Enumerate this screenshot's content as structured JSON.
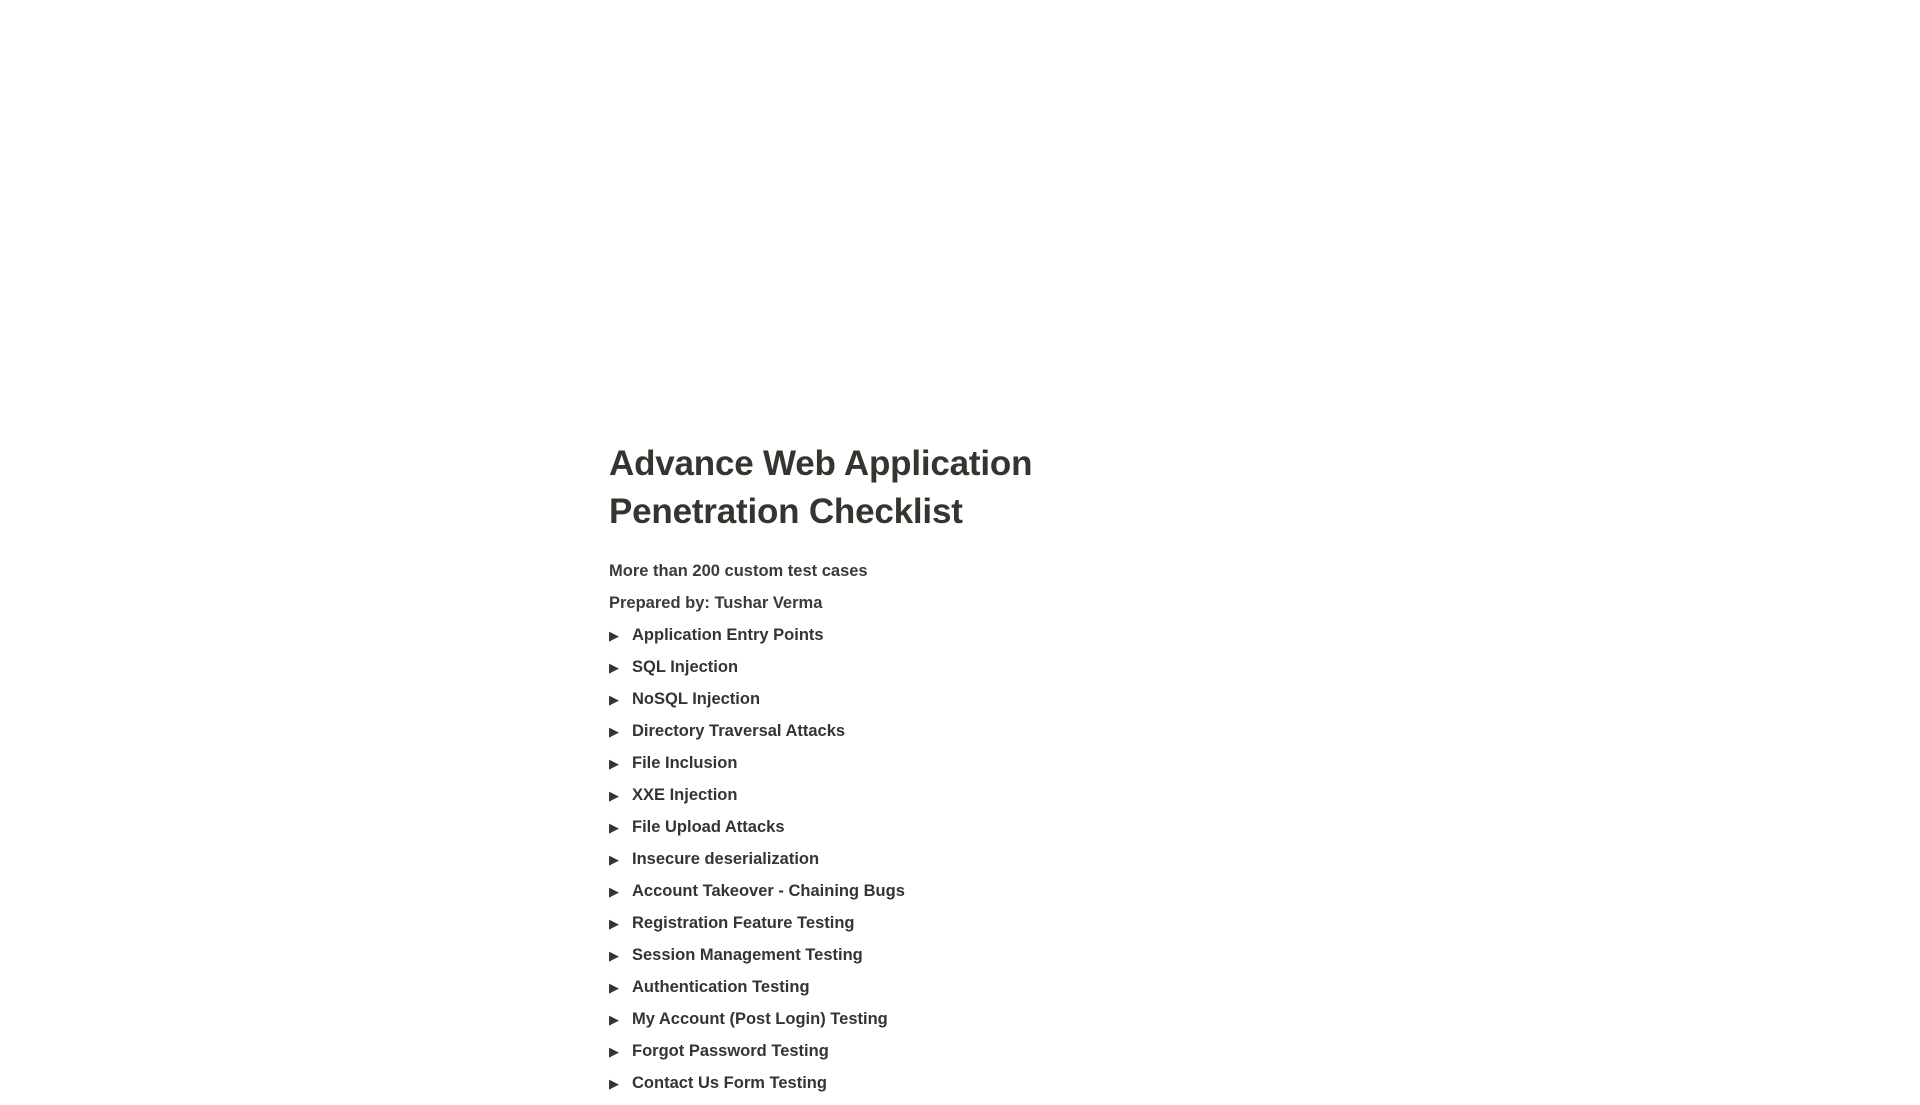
{
  "document": {
    "title_line_1": "Advance Web Application",
    "title_line_2": "Penetration Checklist",
    "subtitle": "More than 200 custom test cases",
    "author_line": "Prepared by: Tushar Verma",
    "text_color": "#36342f",
    "background_color": "#ffffff"
  },
  "toc": {
    "disclosure_icon": "▶",
    "items": [
      {
        "label": "Application Entry Points",
        "icon": "collapsed-triangle-icon",
        "expanded": false
      },
      {
        "label": "SQL Injection",
        "icon": "collapsed-triangle-icon",
        "expanded": false
      },
      {
        "label": "NoSQL Injection",
        "icon": "collapsed-triangle-icon",
        "expanded": false
      },
      {
        "label": "Directory Traversal Attacks",
        "icon": "collapsed-triangle-icon",
        "expanded": false
      },
      {
        "label": "File Inclusion",
        "icon": "collapsed-triangle-icon",
        "expanded": false
      },
      {
        "label": "XXE Injection",
        "icon": "collapsed-triangle-icon",
        "expanded": false
      },
      {
        "label": "File Upload Attacks",
        "icon": "collapsed-triangle-icon",
        "expanded": false
      },
      {
        "label": "Insecure deserialization",
        "icon": "collapsed-triangle-icon",
        "expanded": false
      },
      {
        "label": "Account Takeover - Chaining Bugs",
        "icon": "collapsed-triangle-icon",
        "expanded": false
      },
      {
        "label": "Registration Feature Testing",
        "icon": "collapsed-triangle-icon",
        "expanded": false
      },
      {
        "label": "Session Management Testing",
        "icon": "collapsed-triangle-icon",
        "expanded": false
      },
      {
        "label": "Authentication Testing",
        "icon": "collapsed-triangle-icon",
        "expanded": false
      },
      {
        "label": "My Account (Post Login) Testing",
        "icon": "collapsed-triangle-icon",
        "expanded": false
      },
      {
        "label": "Forgot Password Testing",
        "icon": "collapsed-triangle-icon",
        "expanded": false
      },
      {
        "label": "Contact Us Form Testing",
        "icon": "collapsed-triangle-icon",
        "expanded": false
      }
    ]
  }
}
